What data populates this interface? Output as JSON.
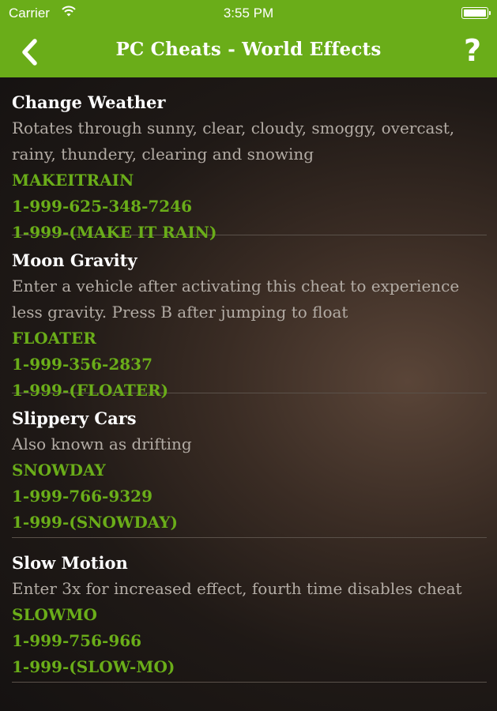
{
  "status_bar": {
    "carrier": "Carrier",
    "time": "3:55 PM"
  },
  "nav": {
    "title": "PC Cheats - World Effects",
    "help": "?"
  },
  "colors": {
    "accent": "#6aad19",
    "header": "#6aad19",
    "text_muted": "#b3aca5"
  },
  "icons": {
    "back": "chevron-left-icon",
    "wifi": "wifi-icon",
    "battery": "battery-icon"
  },
  "cheats": [
    {
      "title": "Change Weather",
      "description": "Rotates through sunny, clear, cloudy, smoggy, overcast, rainy, thundery, clearing and snowing",
      "code": "MAKEITRAIN",
      "phone": "1-999-625-348-7246",
      "phone_words": "1-999-(MAKE IT RAIN)"
    },
    {
      "title": "Moon Gravity",
      "description": "Enter a vehicle after activating this cheat to experience less gravity. Press B after jumping to float",
      "code": "FLOATER",
      "phone": "1-999-356-2837",
      "phone_words": "1-999-(FLOATER)"
    },
    {
      "title": "Slippery Cars",
      "description": "Also known as drifting",
      "code": "SNOWDAY",
      "phone": "1-999-766-9329",
      "phone_words": "1-999-(SNOWDAY)"
    },
    {
      "title": "Slow Motion",
      "description": "Enter 3x for increased effect, fourth time disables cheat",
      "code": "SLOWMO",
      "phone": "1-999-756-966",
      "phone_words": "1-999-(SLOW-MO)"
    }
  ]
}
